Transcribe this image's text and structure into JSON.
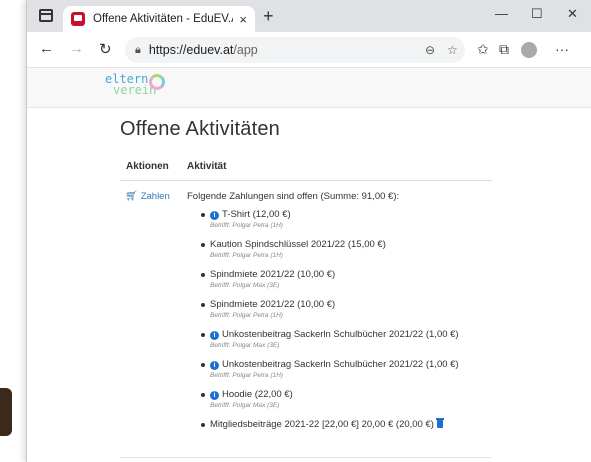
{
  "browser": {
    "tab_title": "Offene Aktivitäten - EduEV.App",
    "tab_close": "×",
    "new_tab": "+",
    "url_host": "https://eduev.at",
    "url_path": "/app",
    "controls": {
      "minimize": "—",
      "maximize": "☐",
      "close": "✕"
    },
    "more": "···"
  },
  "logo": {
    "line1": "eltern",
    "line2": "verein"
  },
  "page": {
    "title": "Offene Aktivitäten",
    "col_actions": "Aktionen",
    "col_activity": "Aktivität"
  },
  "row": {
    "action_label": "Zahlen",
    "intro": "Folgende Zahlungen sind offen (Summe: 91,00 €):",
    "items": [
      {
        "text": "T-Shirt (12,00 €)",
        "sub": "Betrifft: Polgar Petra (1H)"
      },
      {
        "text": "Kaution Spindschlüssel 2021/22 (15,00 €)",
        "sub": "Betrifft: Polgar Petra (1H)"
      },
      {
        "text": "Spindmiete 2021/22 (10,00 €)",
        "sub": "Betrifft: Polgar Max (3E)"
      },
      {
        "text": "Spindmiete 2021/22 (10,00 €)",
        "sub": "Betrifft: Polgar Petra (1H)"
      },
      {
        "text": "Unkostenbeitrag Sackerln Schulbücher 2021/22 (1,00 €)",
        "sub": "Betrifft: Polgar Max (3E)"
      },
      {
        "text": "Unkostenbeitrag Sackerln Schulbücher 2021/22 (1,00 €)",
        "sub": "Betrifft: Polgar Petra (1H)"
      },
      {
        "text": "Hoodie (22,00 €)",
        "sub": "Betrifft: Polgar Max (3E)"
      },
      {
        "text": "Mitgliedsbeiträge 2021-22 [22,00 €] 20,00 € (20,00 €)"
      }
    ]
  },
  "colors": {
    "link": "#337ab7",
    "info": "#1f6fd1",
    "tabbar": "#dfe1e5"
  }
}
